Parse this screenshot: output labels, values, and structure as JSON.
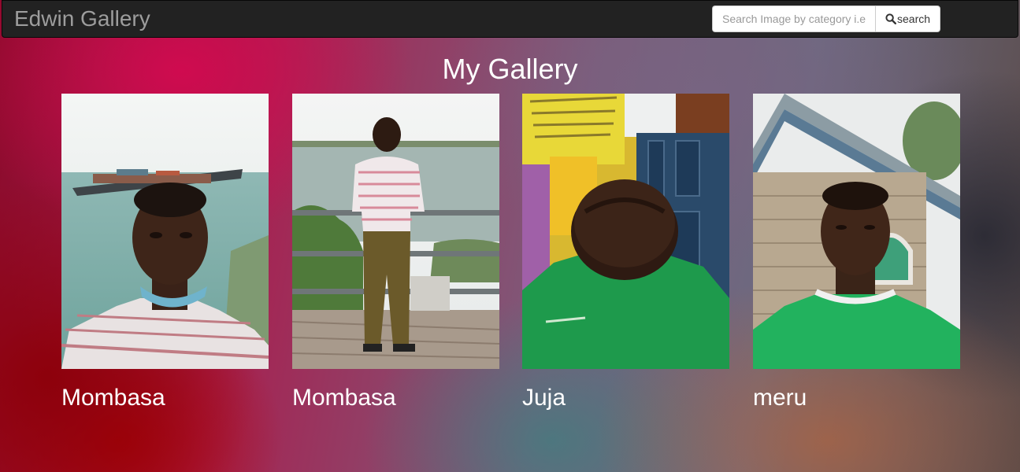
{
  "navbar": {
    "brand": "Edwin Gallery",
    "search_placeholder": "Search Image by category i.e",
    "search_label": "search",
    "search_icon": "search-icon"
  },
  "main": {
    "title": "My Gallery",
    "images": [
      {
        "category": "Mombasa",
        "photo": "selfie by the sea with a container ship"
      },
      {
        "category": "Mombasa",
        "photo": "man standing by a railing at the shore"
      },
      {
        "category": "Juja",
        "photo": "man with head bowed in green shirt"
      },
      {
        "category": "meru",
        "photo": "man in green shirt in front of a house"
      }
    ]
  },
  "colors": {
    "navbar_bg": "#222222",
    "brand_text": "#9d9d9d",
    "text": "#ffffff"
  }
}
